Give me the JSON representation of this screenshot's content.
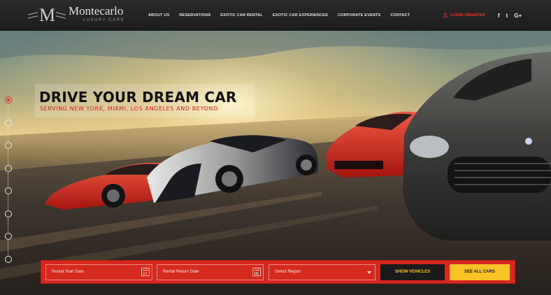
{
  "brand": {
    "mark": "M",
    "name": "Montecarlo",
    "tagline": "LUXURY CARS"
  },
  "nav": {
    "items": [
      "ABOUT US",
      "RESERVATIONS",
      "EXOTIC CAR RENTAL",
      "EXOTIC CAR EXPERIENCES",
      "CORPORATE EVENTS",
      "CONTACT"
    ],
    "login_label": "LOGIN / REGISTER",
    "social": [
      "f",
      "t",
      "G+"
    ]
  },
  "hero": {
    "title": "DRIVE YOUR DREAM CAR",
    "subtitle": "SERVING NEW YORK, MIAMI, LOS ANGELES AND BEYOND"
  },
  "slider": {
    "total": 8,
    "active_index": 0
  },
  "booking": {
    "start_date_placeholder": "Rental Start Date",
    "return_date_placeholder": "Rental Return Date",
    "region_placeholder": "Select Region",
    "show_vehicles_label": "SHOW VEHICLES",
    "see_all_label": "SEE ALL CARS"
  },
  "colors": {
    "accent": "#d6281d",
    "button_yellow": "#f7c325",
    "nav_bg": "#222222"
  }
}
